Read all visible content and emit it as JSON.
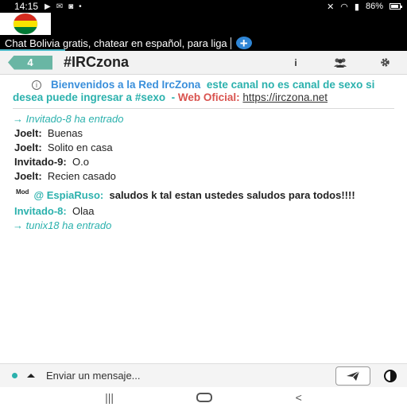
{
  "status_bar": {
    "time": "14:15",
    "battery": "86%"
  },
  "tab": {
    "label": "Chat Bolivia gratis, chatear en español, para liga",
    "add_label": "+"
  },
  "channel": {
    "user_count": "4",
    "name": "#IRCzona",
    "info_label": "i"
  },
  "motd": {
    "welcome": "Bienvenidos a la Red IrcZona",
    "warning": "este canal no es canal de sexo si desea puede ingresar a #sexo",
    "dash": "-",
    "web_label": "Web Oficial:",
    "url": "https://irczona.net"
  },
  "messages": [
    {
      "type": "event",
      "text": "→ Invitado-8 ha entrado"
    },
    {
      "type": "msg",
      "nick": "Joelt:",
      "text": "Buenas"
    },
    {
      "type": "msg",
      "nick": "Joelt:",
      "text": "Solito en casa"
    },
    {
      "type": "msg",
      "nick": "Invitado-9:",
      "text": "O.o"
    },
    {
      "type": "msg",
      "nick": "Joelt:",
      "text": "Recien casado"
    },
    {
      "type": "mod",
      "badge": "Mod",
      "nick": "@ EspiaRuso:",
      "text": "saludos k tal estan ustedes saludos para todos!!!!"
    },
    {
      "type": "msg_green",
      "nick": "Invitado-8:",
      "text": "Olaa"
    },
    {
      "type": "event",
      "text": "→ tunix18 ha entrado"
    }
  ],
  "input": {
    "placeholder": "Enviar un mensaje..."
  },
  "colors": {
    "accent": "#2bb1ad",
    "badge": "#69b6a4",
    "link_blue": "#3a8fdb",
    "web_red": "#d9534f"
  }
}
